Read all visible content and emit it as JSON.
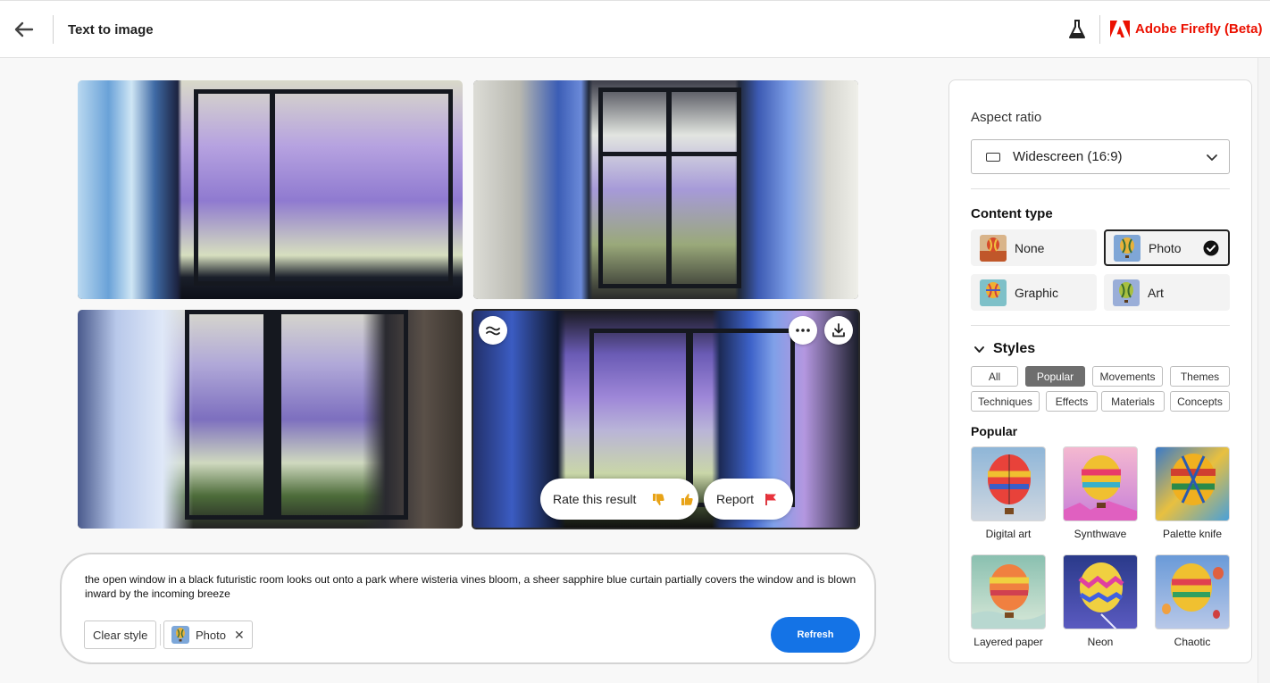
{
  "header": {
    "title": "Text to image",
    "brand": "Adobe Firefly (Beta)"
  },
  "results": {
    "rate_label": "Rate this result",
    "report_label": "Report"
  },
  "prompt": {
    "text": "the open window in a black futuristic room looks out onto a park where wisteria vines bloom, a sheer sapphire blue curtain partially covers the window and is blown inward by the incoming breeze",
    "clear_style_label": "Clear style",
    "chip_label": "Photo",
    "refresh_label": "Refresh"
  },
  "panel": {
    "aspect_ratio_label": "Aspect ratio",
    "aspect_ratio_value": "Widescreen (16:9)",
    "content_type_label": "Content type",
    "content_types": [
      {
        "label": "None",
        "selected": false
      },
      {
        "label": "Photo",
        "selected": true
      },
      {
        "label": "Graphic",
        "selected": false
      },
      {
        "label": "Art",
        "selected": false
      }
    ],
    "styles_label": "Styles",
    "filters": [
      "All",
      "Popular",
      "Movements",
      "Themes",
      "Techniques",
      "Effects",
      "Materials",
      "Concepts"
    ],
    "active_filter": "Popular",
    "popular_label": "Popular",
    "styles": [
      "Digital art",
      "Synthwave",
      "Palette knife",
      "Layered paper",
      "Neon",
      "Chaotic"
    ]
  },
  "colors": {
    "brand_red": "#eb1000",
    "accent_blue": "#1473e6"
  }
}
